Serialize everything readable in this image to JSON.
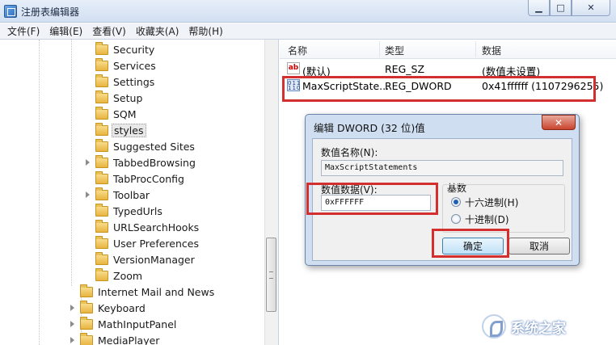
{
  "window": {
    "title": "注册表编辑器"
  },
  "menu": [
    "文件(F)",
    "编辑(E)",
    "查看(V)",
    "收藏夹(A)",
    "帮助(H)"
  ],
  "tree": {
    "items": [
      {
        "label": "Security",
        "expandable": false,
        "selected": false
      },
      {
        "label": "Services",
        "expandable": false,
        "selected": false
      },
      {
        "label": "Settings",
        "expandable": false,
        "selected": false
      },
      {
        "label": "Setup",
        "expandable": false,
        "selected": false
      },
      {
        "label": "SQM",
        "expandable": false,
        "selected": false
      },
      {
        "label": "styles",
        "expandable": false,
        "selected": true
      },
      {
        "label": "Suggested Sites",
        "expandable": false,
        "selected": false
      },
      {
        "label": "TabbedBrowsing",
        "expandable": true,
        "selected": false
      },
      {
        "label": "TabProcConfig",
        "expandable": false,
        "selected": false
      },
      {
        "label": "Toolbar",
        "expandable": true,
        "selected": false
      },
      {
        "label": "TypedUrls",
        "expandable": false,
        "selected": false
      },
      {
        "label": "URLSearchHooks",
        "expandable": false,
        "selected": false
      },
      {
        "label": "User Preferences",
        "expandable": false,
        "selected": false
      },
      {
        "label": "VersionManager",
        "expandable": false,
        "selected": false
      },
      {
        "label": "Zoom",
        "expandable": false,
        "selected": false
      }
    ],
    "parent_items": [
      {
        "label": "Internet Mail and News",
        "expandable": false
      },
      {
        "label": "Keyboard",
        "expandable": true
      },
      {
        "label": "MathInputPanel",
        "expandable": true
      },
      {
        "label": "MediaPlayer",
        "expandable": true
      }
    ]
  },
  "list": {
    "headers": {
      "name": "名称",
      "type": "类型",
      "data": "数据"
    },
    "rows": [
      {
        "icon": "string-value-icon",
        "name": "(默认)",
        "type": "REG_SZ",
        "data": "(数值未设置)"
      },
      {
        "icon": "dword-value-icon",
        "name": "MaxScriptState...",
        "type": "REG_DWORD",
        "data": "0x41ffffff (1107296255)"
      }
    ]
  },
  "dialog": {
    "title": "编辑 DWORD (32 位)值",
    "close_label": "✕",
    "name_label": "数值名称(N):",
    "name_value": "MaxScriptStatements",
    "data_label": "数值数据(V):",
    "data_value": "0xFFFFFF",
    "base_label": "基数",
    "base_options": [
      {
        "label": "十六进制(H)",
        "checked": true
      },
      {
        "label": "十进制(D)",
        "checked": false
      }
    ],
    "ok_label": "确定",
    "cancel_label": "取消"
  },
  "watermark": {
    "text": "系统之家"
  },
  "colors": {
    "highlight": "#d32f2f",
    "title_bar": "#d3e0f2",
    "dialog_frame": "#cfdff1"
  }
}
